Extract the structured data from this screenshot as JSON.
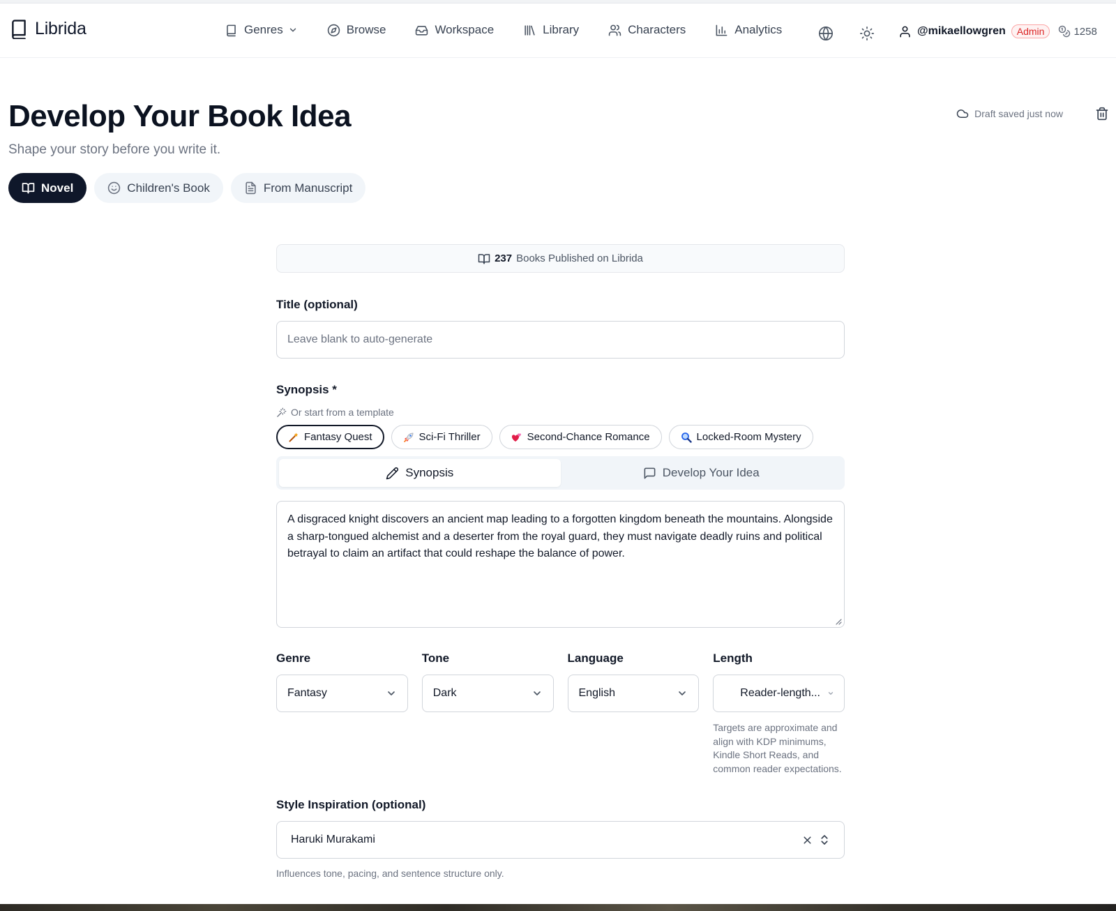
{
  "colors": {
    "accent": "#0f172a",
    "admin_badge": "#dc2626",
    "muted": "#6b7280"
  },
  "brand": {
    "name": "Librida",
    "icon": "book-icon"
  },
  "nav": {
    "items": [
      {
        "label": "Genres",
        "icon": "book-icon",
        "has_dropdown": true
      },
      {
        "label": "Browse",
        "icon": "compass-icon"
      },
      {
        "label": "Workspace",
        "icon": "inbox-icon"
      },
      {
        "label": "Library",
        "icon": "library-icon"
      },
      {
        "label": "Characters",
        "icon": "users-icon"
      },
      {
        "label": "Analytics",
        "icon": "bar-chart-icon"
      }
    ],
    "language_icon": "globe-icon",
    "theme_icon": "sun-icon",
    "user": {
      "name": "@mikaellowgren",
      "role": "Admin",
      "credits": "1258",
      "credits_icon": "coins-icon"
    }
  },
  "header": {
    "title": "Develop Your Book Idea",
    "subtitle": "Shape your story before you write it.",
    "draft_status": "Draft saved just now"
  },
  "mode_tabs": [
    {
      "label": "Novel",
      "icon": "open-book-icon",
      "active": true
    },
    {
      "label": "Children's Book",
      "icon": "smile-icon",
      "active": false
    },
    {
      "label": "From Manuscript",
      "icon": "file-text-icon",
      "active": false
    }
  ],
  "stats": {
    "count": "237",
    "text": "Books Published on Librida"
  },
  "form": {
    "title_label": "Title (optional)",
    "title_placeholder": "Leave blank to auto-generate",
    "synopsis_label": "Synopsis *",
    "template_hint": "Or start from a template",
    "templates": [
      {
        "label": "Fantasy Quest",
        "emoji": "magic-wand",
        "active": true
      },
      {
        "label": "Sci-Fi Thriller",
        "emoji": "rocket",
        "active": false
      },
      {
        "label": "Second-Chance Romance",
        "emoji": "two-hearts",
        "active": false
      },
      {
        "label": "Locked-Room Mystery",
        "emoji": "magnifier",
        "active": false
      }
    ],
    "tabs": [
      {
        "label": "Synopsis",
        "icon": "pencil-icon",
        "active": true
      },
      {
        "label": "Develop Your Idea",
        "icon": "message-square-icon",
        "active": false
      }
    ],
    "synopsis_text": "A disgraced knight discovers an ancient map leading to a forgotten kingdom beneath the mountains. Alongside a sharp-tongued alchemist and a deserter from the royal guard, they must navigate deadly ruins and political betrayal to claim an artifact that could reshape the balance of power.",
    "genre": {
      "label": "Genre",
      "value": "Fantasy"
    },
    "tone": {
      "label": "Tone",
      "value": "Dark"
    },
    "language": {
      "label": "Language",
      "value": "English"
    },
    "length": {
      "label": "Length",
      "value": "Reader-length..."
    },
    "length_note": "Targets are approximate and align with KDP minimums, Kindle Short Reads, and common reader expectations.",
    "style_label": "Style Inspiration (optional)",
    "style_value": "Haruki Murakami",
    "style_note": "Influences tone, pacing, and sentence structure only."
  }
}
